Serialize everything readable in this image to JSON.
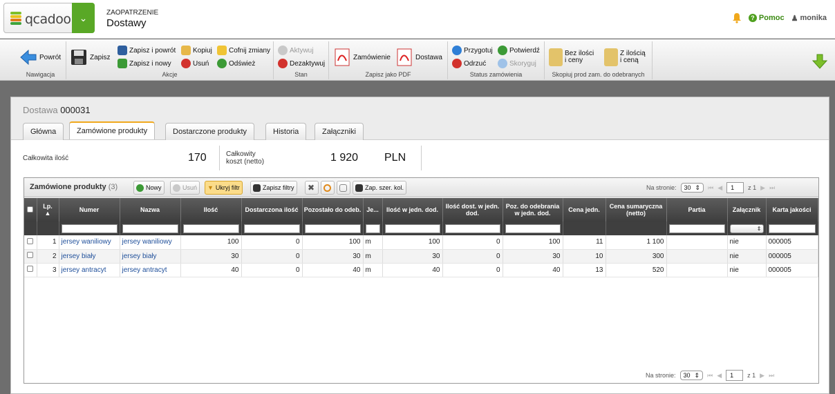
{
  "header": {
    "logo": "qcadoo",
    "module": "ZAOPATRZENIE",
    "title": "Dostawy",
    "help": "Pomoc",
    "user": "monika"
  },
  "ribbon": {
    "nav": {
      "back": "Powrót",
      "label": "Nawigacja"
    },
    "actions": {
      "save": "Zapisz",
      "save_back": "Zapisz i powrót",
      "save_new": "Zapisz i nowy",
      "copy": "Kopiuj",
      "delete": "Usuń",
      "undo": "Cofnij zmiany",
      "refresh": "Odśwież",
      "label": "Akcje"
    },
    "state": {
      "activate": "Aktywuj",
      "deactivate": "Dezaktywuj",
      "label": "Stan"
    },
    "pdf": {
      "order": "Zamówienie",
      "delivery": "Dostawa",
      "label": "Zapisz jako PDF"
    },
    "status": {
      "prepare": "Przygotuj",
      "approve": "Potwierdź",
      "decline": "Odrzuć",
      "correct": "Skoryguj",
      "label": "Status zamówienia"
    },
    "copy": {
      "without": "Bez ilości\ni ceny",
      "with": "Z ilością\ni ceną",
      "label": "Skopiuj prod zam. do odebranych"
    }
  },
  "doc": {
    "label": "Dostawa",
    "number": "000031"
  },
  "tabs": [
    "Główna",
    "Zamówione produkty",
    "Dostarczone produkty",
    "Historia",
    "Załączniki"
  ],
  "summary": {
    "total_qty_label": "Całkowita ilość",
    "total_qty": "170",
    "total_cost_label1": "Całkowity",
    "total_cost_label2": "koszt (netto)",
    "total_cost": "1 920",
    "currency": "PLN"
  },
  "grid": {
    "title": "Zamówione produkty",
    "count": "(3)",
    "buttons": {
      "new": "Nowy",
      "delete": "Usuń",
      "hide_filter": "Ukryj filtr",
      "save_filters": "Zapisz filtry",
      "save_widths": "Zap. szer. kol."
    },
    "per_page_label": "Na stronie:",
    "per_page": "30",
    "page": "1",
    "of": "z 1",
    "columns": [
      "Lp.",
      "Numer",
      "Nazwa",
      "Ilość",
      "Dostarczona ilość",
      "Pozostało do odeb.",
      "Je...",
      "Ilość w jedn. dod.",
      "Ilość dost. w jedn. dod.",
      "Poz. do odebrania w jedn. dod.",
      "Cena jedn.",
      "Cena sumaryczna (netto)",
      "Partia",
      "Załącznik",
      "Karta jakości"
    ],
    "rows": [
      {
        "lp": "1",
        "number": "jersey waniliowy",
        "name": "jersey waniliowy",
        "qty": "100",
        "delivered": "0",
        "remaining": "100",
        "unit": "m",
        "qty_add": "100",
        "delivered_add": "0",
        "remaining_add": "100",
        "price": "11",
        "total": "1 100",
        "batch": "",
        "attachment": "nie",
        "quality": "000005"
      },
      {
        "lp": "2",
        "number": "jersey biały",
        "name": "jersey biały",
        "qty": "30",
        "delivered": "0",
        "remaining": "30",
        "unit": "m",
        "qty_add": "30",
        "delivered_add": "0",
        "remaining_add": "30",
        "price": "10",
        "total": "300",
        "batch": "",
        "attachment": "nie",
        "quality": "000005"
      },
      {
        "lp": "3",
        "number": "jersey antracyt",
        "name": "jersey antracyt",
        "qty": "40",
        "delivered": "0",
        "remaining": "40",
        "unit": "m",
        "qty_add": "40",
        "delivered_add": "0",
        "remaining_add": "40",
        "price": "13",
        "total": "520",
        "batch": "",
        "attachment": "nie",
        "quality": "000005"
      }
    ]
  }
}
